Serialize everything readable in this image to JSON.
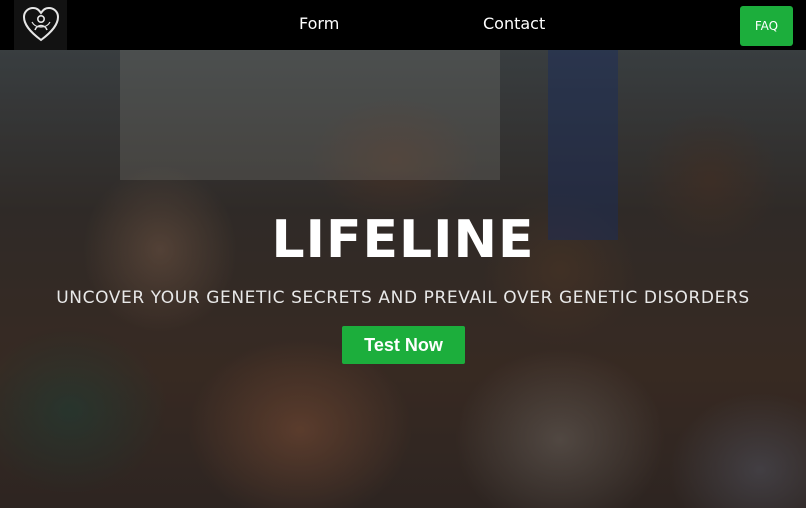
{
  "nav": {
    "logo_icon": "heart-figure-logo-icon",
    "links": [
      {
        "label": "Form"
      },
      {
        "label": "Contact"
      }
    ],
    "faq_label": "FAQ"
  },
  "hero": {
    "background": "photo of a group of smiling children",
    "title": "LIFELINE",
    "subtitle": "UNCOVER YOUR GENETIC SECRETS AND PREVAIL OVER GENETIC DISORDERS",
    "cta_label": "Test Now"
  },
  "colors": {
    "navbar_bg": "#000000",
    "accent_green": "#1cae3c",
    "text_white": "#ffffff"
  }
}
